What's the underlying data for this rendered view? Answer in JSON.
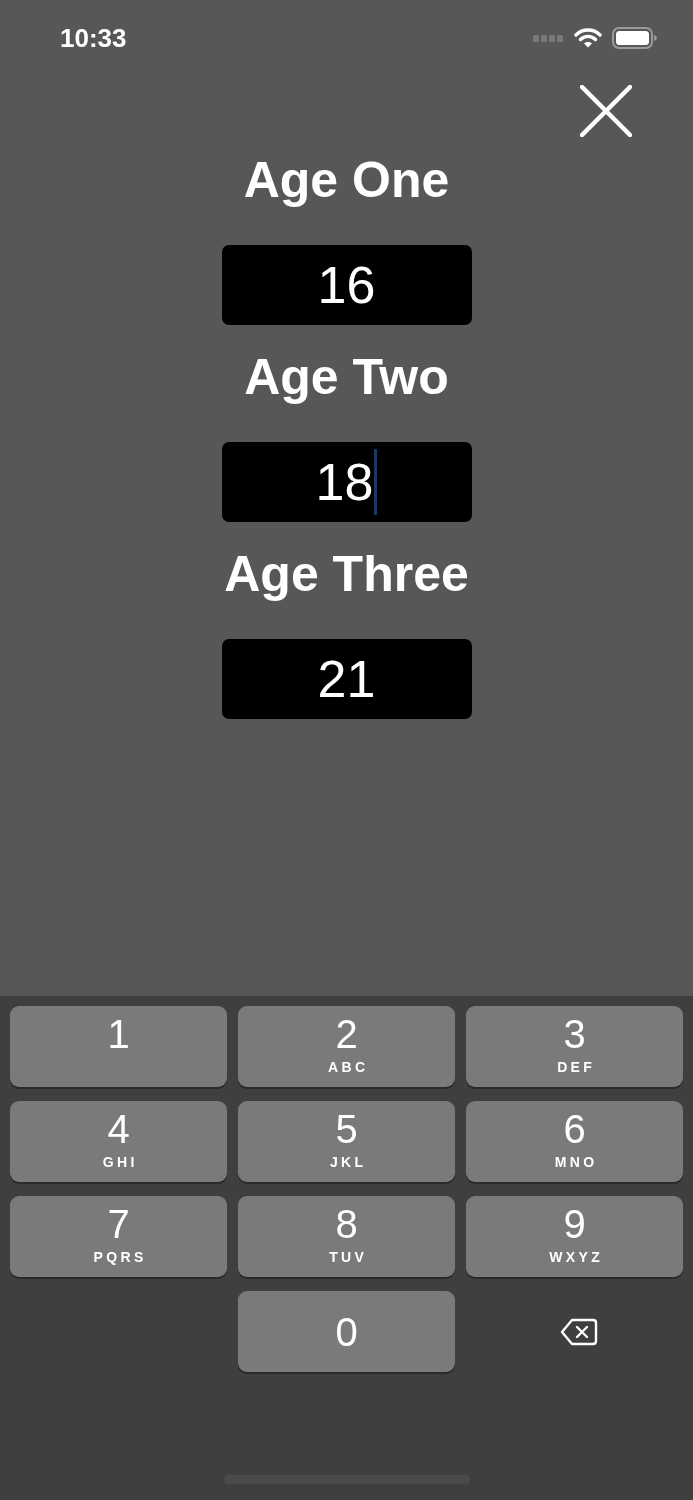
{
  "status_bar": {
    "time": "10:33"
  },
  "fields": [
    {
      "label": "Age One",
      "value": "16",
      "focused": false
    },
    {
      "label": "Age Two",
      "value": "18",
      "focused": true
    },
    {
      "label": "Age Three",
      "value": "21",
      "focused": false
    }
  ],
  "keypad": {
    "rows": [
      [
        {
          "kind": "digit",
          "digit": "1"
        },
        {
          "kind": "digit",
          "digit": "2",
          "letters": "ABC"
        },
        {
          "kind": "digit",
          "digit": "3",
          "letters": "DEF"
        }
      ],
      [
        {
          "kind": "digit",
          "digit": "4",
          "letters": "GHI"
        },
        {
          "kind": "digit",
          "digit": "5",
          "letters": "JKL"
        },
        {
          "kind": "digit",
          "digit": "6",
          "letters": "MNO"
        }
      ],
      [
        {
          "kind": "digit",
          "digit": "7",
          "letters": "PQRS"
        },
        {
          "kind": "digit",
          "digit": "8",
          "letters": "TUV"
        },
        {
          "kind": "digit",
          "digit": "9",
          "letters": "WXYZ"
        }
      ],
      [
        "",
        {
          "kind": "digit",
          "digit": "0"
        },
        {
          "kind": "delete"
        }
      ]
    ]
  }
}
